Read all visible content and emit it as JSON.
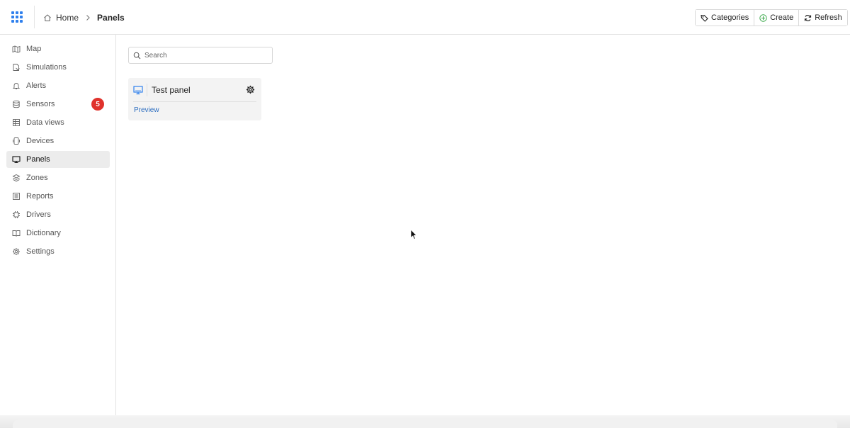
{
  "breadcrumb": {
    "home": "Home",
    "current": "Panels"
  },
  "toolbar": {
    "categories": "Categories",
    "create": "Create",
    "refresh": "Refresh"
  },
  "colors": {
    "accent": "#2f80ed",
    "badge": "#e0322c",
    "create_icon": "#3aa84a",
    "link": "#2f6fc0"
  },
  "sidebar": {
    "items": [
      {
        "label": "Map",
        "icon": "map-icon"
      },
      {
        "label": "Simulations",
        "icon": "simulations-icon"
      },
      {
        "label": "Alerts",
        "icon": "bell-icon"
      },
      {
        "label": "Sensors",
        "icon": "database-icon",
        "badge": "5"
      },
      {
        "label": "Data views",
        "icon": "table-icon"
      },
      {
        "label": "Devices",
        "icon": "device-icon"
      },
      {
        "label": "Panels",
        "icon": "monitor-icon",
        "active": true
      },
      {
        "label": "Zones",
        "icon": "layers-icon"
      },
      {
        "label": "Reports",
        "icon": "report-icon"
      },
      {
        "label": "Drivers",
        "icon": "chip-icon"
      },
      {
        "label": "Dictionary",
        "icon": "book-icon"
      },
      {
        "label": "Settings",
        "icon": "gear-icon"
      }
    ]
  },
  "search": {
    "placeholder": "Search",
    "value": ""
  },
  "panels": [
    {
      "title": "Test panel",
      "link": "Preview"
    }
  ]
}
